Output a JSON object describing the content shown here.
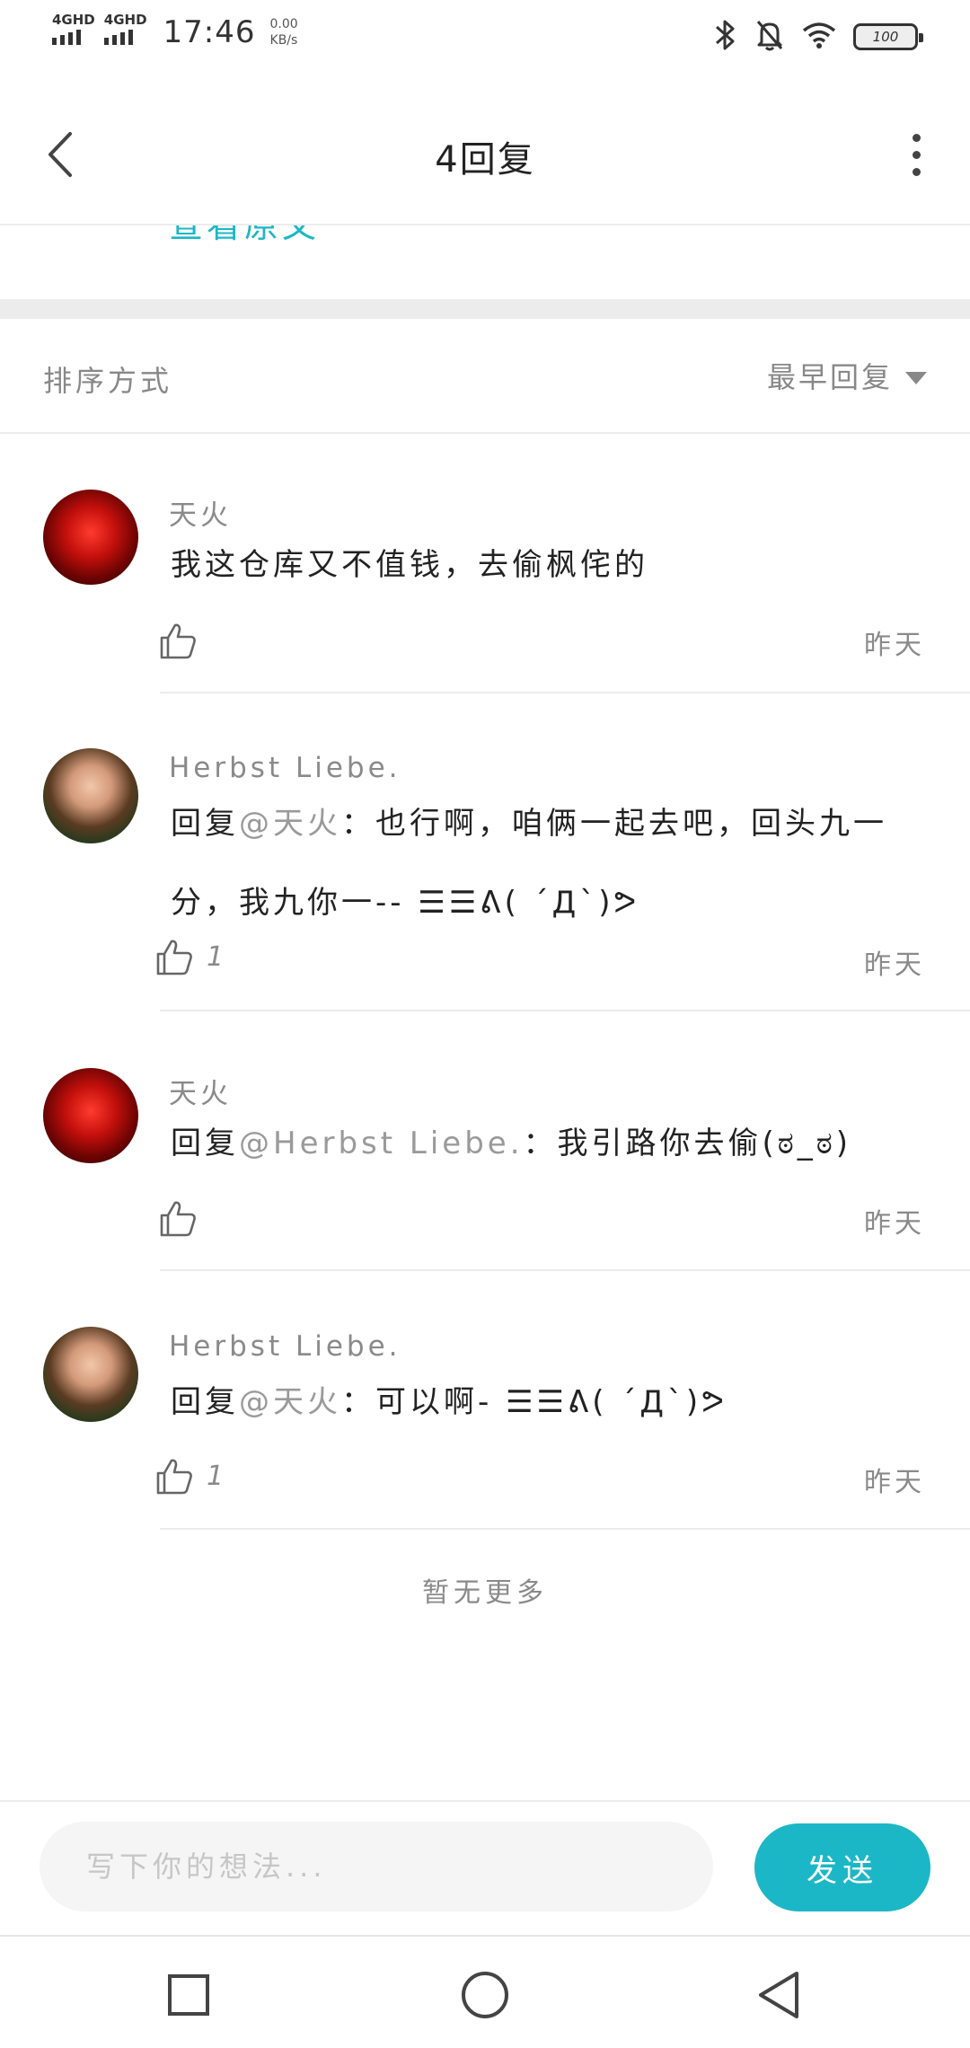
{
  "status_bar": {
    "signal_1": "4GHD",
    "signal_2": "4GHD",
    "time": "17:46",
    "speed_value": "0.00",
    "speed_unit": "KB/s",
    "battery": "100"
  },
  "header": {
    "title": "4回复",
    "partial_link": "查看原文"
  },
  "sort": {
    "label": "排序方式",
    "value": "最早回复"
  },
  "comments": [
    {
      "author": "天火",
      "reply_prefix": "",
      "mention": "",
      "text": "我这仓库又不值钱，去偷枫侘的",
      "likes": "",
      "time": "昨天"
    },
    {
      "author": "Herbst Liebe.",
      "reply_prefix": "回复",
      "mention": "@天火",
      "text": "：也行啊，咱俩一起去吧，回头九一分，我九你一-- ☰☰ᕕ( ´Д`)ᕗ",
      "likes": "1",
      "time": "昨天"
    },
    {
      "author": "天火",
      "reply_prefix": "回复",
      "mention": "@Herbst Liebe.",
      "text": "：我引路你去偷(ಠ_ಠ)",
      "likes": "",
      "time": "昨天"
    },
    {
      "author": "Herbst Liebe.",
      "reply_prefix": "回复",
      "mention": "@天火",
      "text": "：可以啊- ☰☰ᕕ( ´Д`)ᕗ",
      "likes": "1",
      "time": "昨天"
    }
  ],
  "no_more": "暂无更多",
  "input": {
    "placeholder": "写下你的想法...",
    "send_label": "发送"
  },
  "colors": {
    "accent": "#1cb7c6",
    "muted_text": "#8a8a8a",
    "divider": "#ececec"
  },
  "icons": {
    "back": "chevron-left-icon",
    "more": "more-vertical-icon",
    "like": "thumbs-up-icon",
    "nav_recent": "square-icon",
    "nav_home": "circle-icon",
    "nav_back": "triangle-back-icon"
  }
}
